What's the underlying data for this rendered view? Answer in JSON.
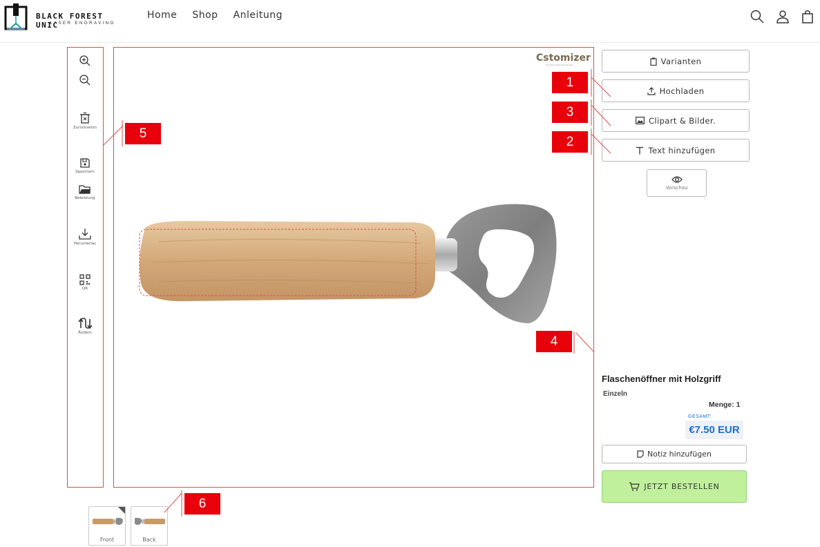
{
  "header": {
    "logo_name": "BLACK FOREST UNIC",
    "logo_sub": "LASER ENGRAVING",
    "nav": [
      "Home",
      "Shop",
      "Anleitung"
    ],
    "icons": [
      "search-icon",
      "account-icon",
      "cart-icon"
    ]
  },
  "toolbar": {
    "reset_label": "Zurücksetzn",
    "save_label": "Speichern",
    "load_label": "Beleistung",
    "download_label": "Herunterlac",
    "qr_label": "QR",
    "change_label": "Ändern"
  },
  "canvas": {
    "brand": "Cstomizer",
    "brand_sub": "Ihr Online Produktkonfigurator"
  },
  "actions": {
    "variants": "Varianten",
    "upload": "Hochladen",
    "clipart": "Clipart & Bilder.",
    "text": "Text hinzufügen",
    "preview": "Vorschau"
  },
  "product": {
    "title": "Flaschenöffner mit Holzgriff",
    "variant": "Einzeln",
    "quantity": "Menge: 1",
    "total_label": "GESAMT:",
    "total": "€7.50 EUR",
    "note_button": "Notiz hinzufügen",
    "order_button": "JETZT BESTELLEN"
  },
  "views": {
    "front": "Front",
    "back": "Back"
  },
  "annotations": [
    "1",
    "3",
    "2",
    "4",
    "5",
    "6"
  ],
  "colors": {
    "annotation": "#e8000b",
    "order_button": "#c0f09c",
    "price": "#1a6fd0"
  }
}
